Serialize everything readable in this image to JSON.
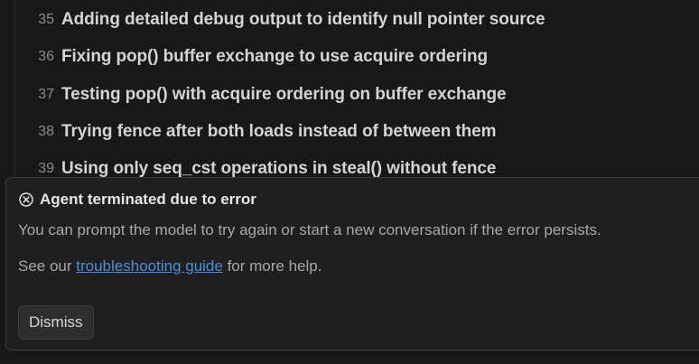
{
  "plan_list": {
    "items": [
      {
        "number": "35",
        "text": "Adding detailed debug output to identify null pointer source"
      },
      {
        "number": "36",
        "text": "Fixing pop() buffer exchange to use acquire ordering"
      },
      {
        "number": "37",
        "text": "Testing pop() with acquire ordering on buffer exchange"
      },
      {
        "number": "38",
        "text": "Trying fence after both loads instead of between them"
      },
      {
        "number": "39",
        "text": "Using only seq_cst operations in steal() without fence"
      }
    ]
  },
  "error_panel": {
    "icon": "circle-x-icon",
    "title": "Agent terminated due to error",
    "message": "You can prompt the model to try again or start a new conversation if the error persists.",
    "help_prefix": "See our ",
    "help_link": "troubleshooting guide",
    "help_suffix": " for more help.",
    "dismiss_label": "Dismiss"
  },
  "colors": {
    "background": "#181818",
    "panel": "#1f1f1f",
    "link": "#4e8fd6"
  }
}
